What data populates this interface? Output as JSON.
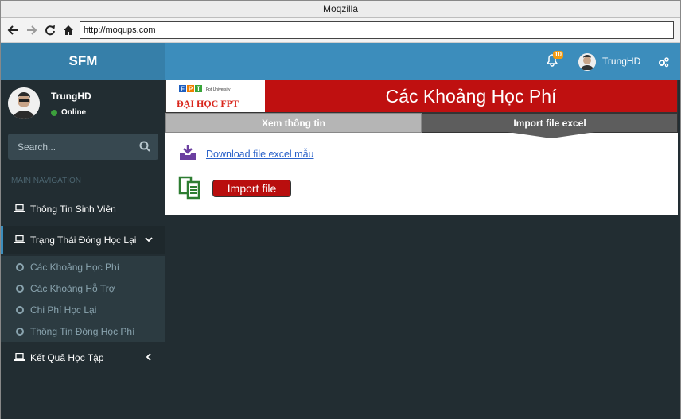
{
  "browser": {
    "title": "Moqzilla",
    "url": "http://moqups.com"
  },
  "header": {
    "logo": "SFM",
    "notification_count": "10",
    "username": "TrungHD"
  },
  "sidebar": {
    "user": {
      "name": "TrungHD",
      "status": "Online"
    },
    "search": {
      "placeholder": "Search..."
    },
    "section_header": "MAIN NAVIGATION",
    "items": [
      {
        "label": "Thông Tin Sinh Viên"
      },
      {
        "label": "Trạng Thái Đóng Học Lại"
      },
      {
        "label": "Kết Quả Học Tập"
      }
    ],
    "subitems": [
      {
        "label": "Các Khoảng Học Phí"
      },
      {
        "label": "Các Khoảng Hỗ Trợ"
      },
      {
        "label": "Chi Phí Học Lại"
      },
      {
        "label": "Thông Tin Đóng Học Phí"
      }
    ]
  },
  "main": {
    "logo": {
      "small": "Fpt University",
      "big": "ĐẠI HỌC FPT"
    },
    "banner_title": "Các Khoảng Học Phí",
    "tabs": [
      {
        "label": "Xem thông tin"
      },
      {
        "label": "Import file excel"
      }
    ],
    "download_link": "Download file excel mẫu",
    "import_button": "Import file"
  },
  "colors": {
    "header": "#3c8dbc",
    "sidebar": "#222d32",
    "banner": "#bf1010",
    "import_button": "#b90e0e",
    "link": "#2a62c9"
  }
}
